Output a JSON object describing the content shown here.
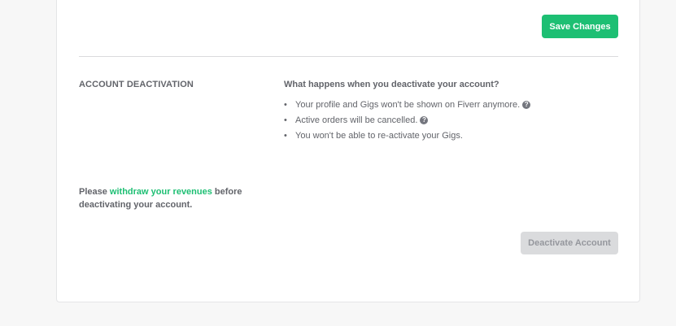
{
  "save_button": {
    "label": "Save Changes"
  },
  "deactivation": {
    "section_title": "ACCOUNT DEACTIVATION",
    "question": "What happens when you deactivate your account?",
    "bullets": [
      {
        "text": "Your profile and Gigs won't be shown on Fiverr anymore.",
        "has_help": true
      },
      {
        "text": "Active orders will be cancelled.",
        "has_help": true
      },
      {
        "text": "You won't be able to re-activate your Gigs.",
        "has_help": false
      }
    ],
    "bullet_marker": "•",
    "help_icon_glyph": "?",
    "notice_prefix": "Please ",
    "notice_link": "withdraw your revenues",
    "notice_suffix": " before deactivating your account.",
    "deactivate_button": {
      "label": "Deactivate Account",
      "disabled": true
    }
  },
  "colors": {
    "accent": "#1dbf73",
    "text": "#62646a",
    "disabled_bg": "#dadbdd",
    "disabled_text": "#95979d"
  }
}
